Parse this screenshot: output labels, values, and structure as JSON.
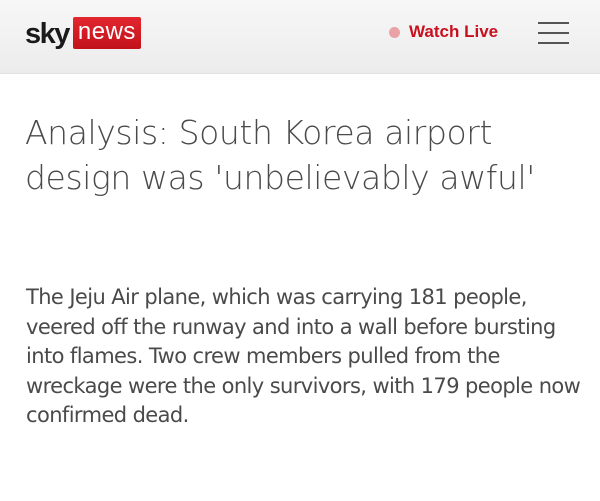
{
  "header": {
    "logo": {
      "sky": "sky",
      "news": "news"
    },
    "watch_live": {
      "label": "Watch Live",
      "dot_color": "#e9a3a6",
      "label_color": "#c8101f"
    },
    "menu_icon": "hamburger-menu-icon"
  },
  "article": {
    "headline": "Analysis: South Korea airport design was 'unbelievably awful'",
    "standfirst": "The Jeju Air plane, which was carrying 181 people, veered off the runway and into a wall before bursting into flames. Two crew members pulled from the wreckage were the only survivors, with 179 people now confirmed dead."
  },
  "colors": {
    "brand_red": "#d11b24",
    "text": "#4a4a4a"
  }
}
